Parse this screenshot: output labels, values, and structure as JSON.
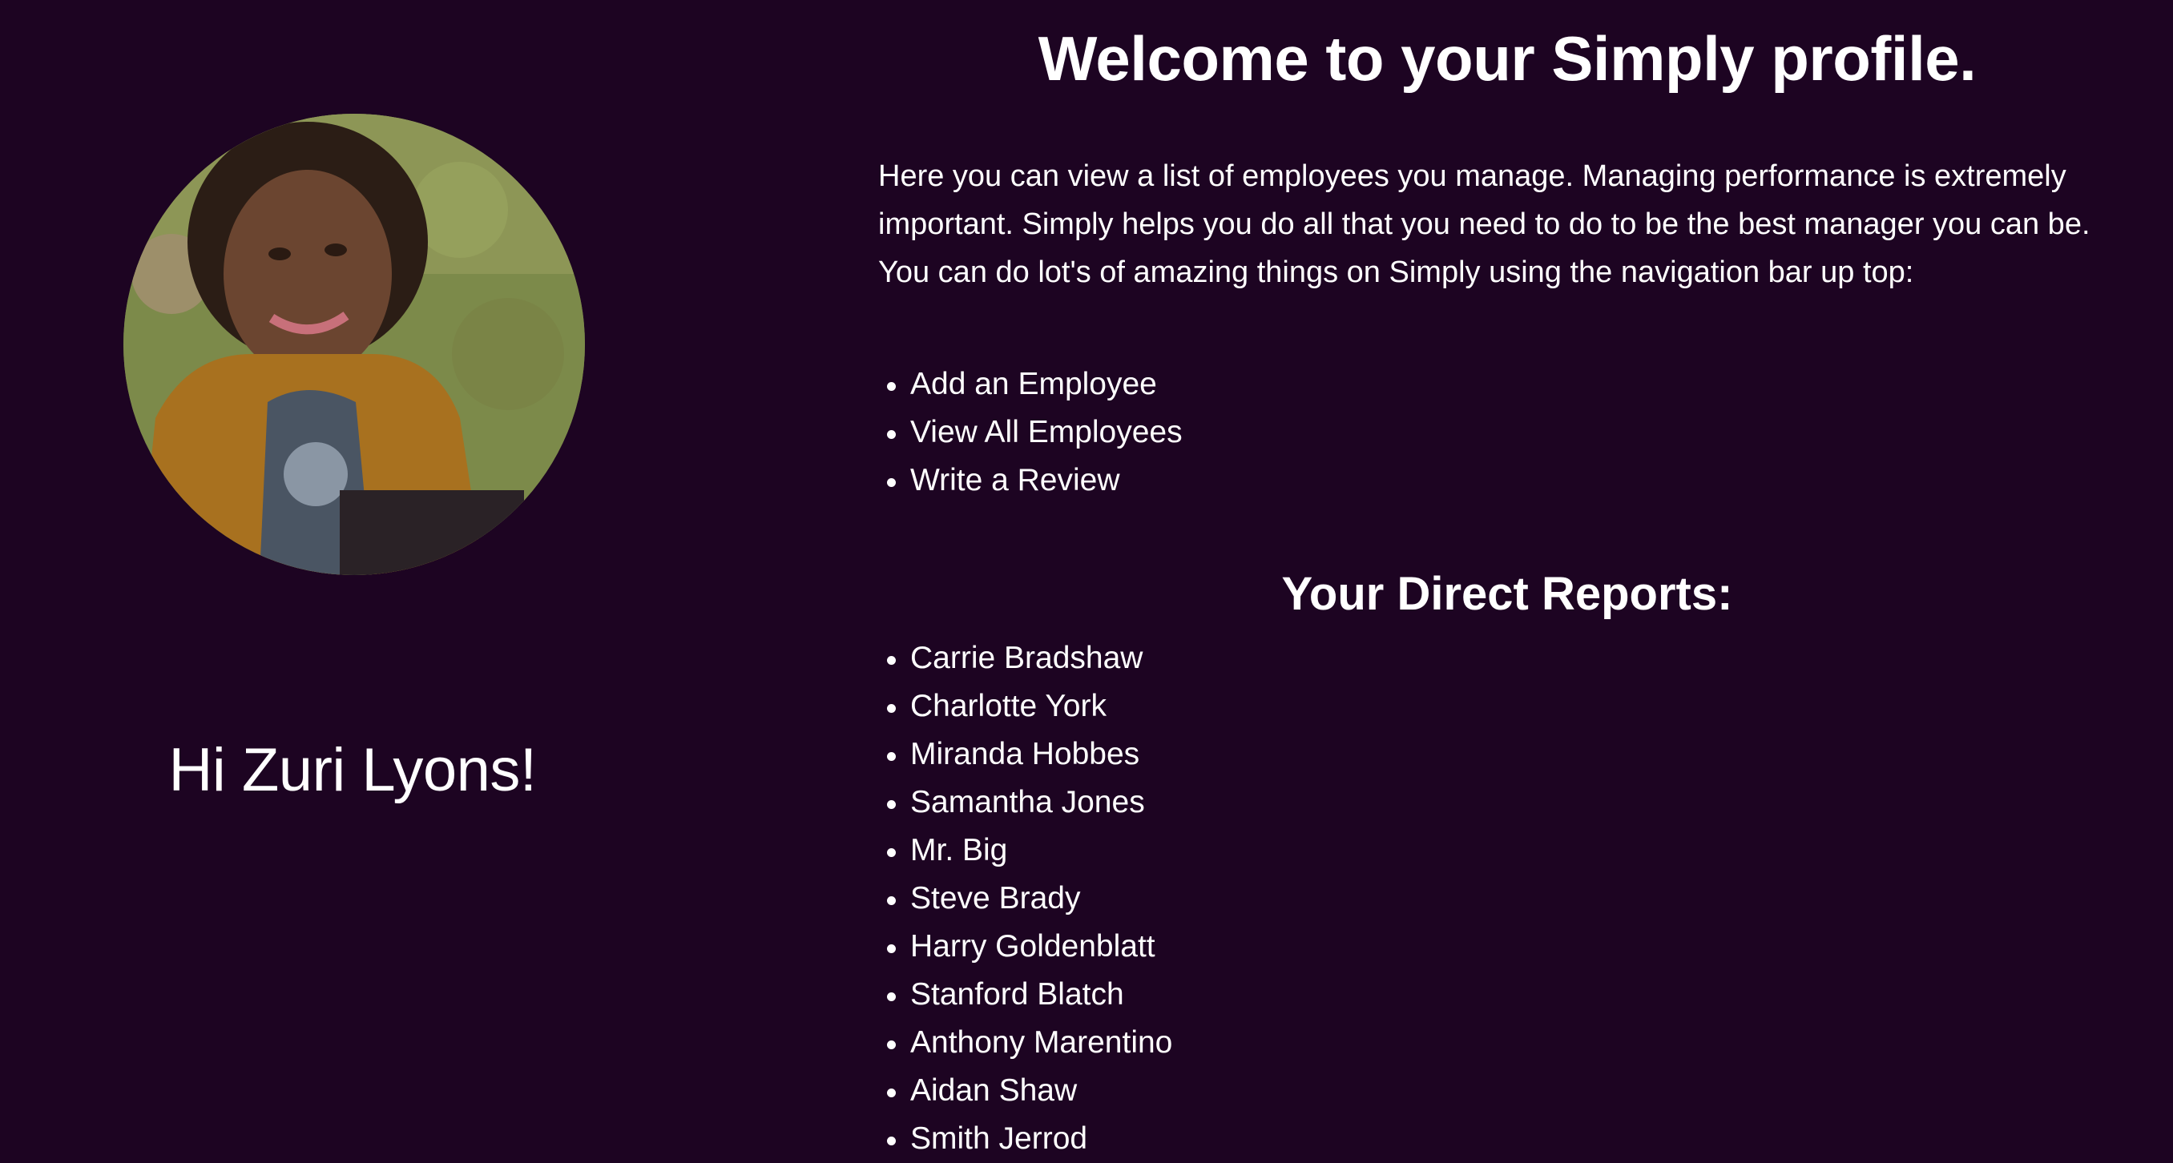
{
  "profile": {
    "greeting": "Hi Zuri Lyons!",
    "avatar_icon": "profile-photo"
  },
  "main": {
    "title": "Welcome to your Simply profile.",
    "intro": "Here you can view a list of employees you manage. Managing performance is extremely important. Simply helps you do all that you need to do to be the best manager you can be. You can do lot's of amazing things on Simply using the navigation bar up top:",
    "nav_items": [
      "Add an Employee",
      "View All Employees",
      "Write a Review"
    ],
    "reports_heading": "Your Direct Reports:",
    "reports": [
      "Carrie Bradshaw",
      "Charlotte York",
      "Miranda Hobbes",
      "Samantha Jones",
      "Mr. Big",
      "Steve Brady",
      "Harry Goldenblatt",
      "Stanford Blatch",
      "Anthony Marentino",
      "Aidan Shaw",
      "Smith Jerrod"
    ]
  },
  "colors": {
    "background": "#1d0422",
    "text": "#ffffff"
  }
}
